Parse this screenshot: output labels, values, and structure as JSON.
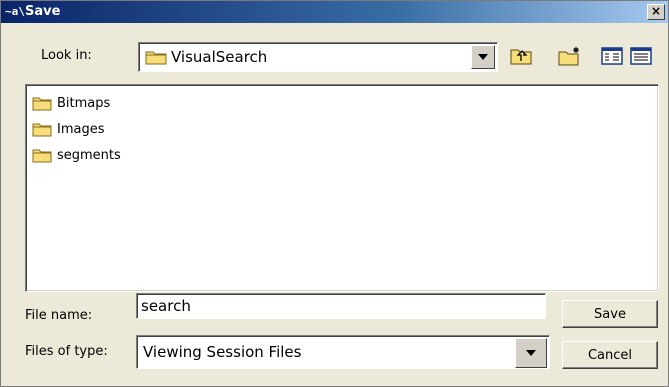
{
  "window": {
    "title": "Save",
    "app_glyph": "~a\\"
  },
  "lookin": {
    "label": "Look in:",
    "value": "VisualSearch"
  },
  "toolbar": {
    "up_icon": "up-folder-icon",
    "new_folder_icon": "new-folder-icon",
    "view_icon": "view-details-icon"
  },
  "files": [
    {
      "name": "Bitmaps",
      "icon": "folder-icon"
    },
    {
      "name": "Images",
      "icon": "folder-icon"
    },
    {
      "name": "segments",
      "icon": "folder-icon"
    }
  ],
  "filename": {
    "label": "File name:",
    "value": "search"
  },
  "filetype": {
    "label": "Files of type:",
    "value": "Viewing Session Files"
  },
  "buttons": {
    "save": "Save",
    "cancel": "Cancel"
  },
  "close_glyph": "×"
}
